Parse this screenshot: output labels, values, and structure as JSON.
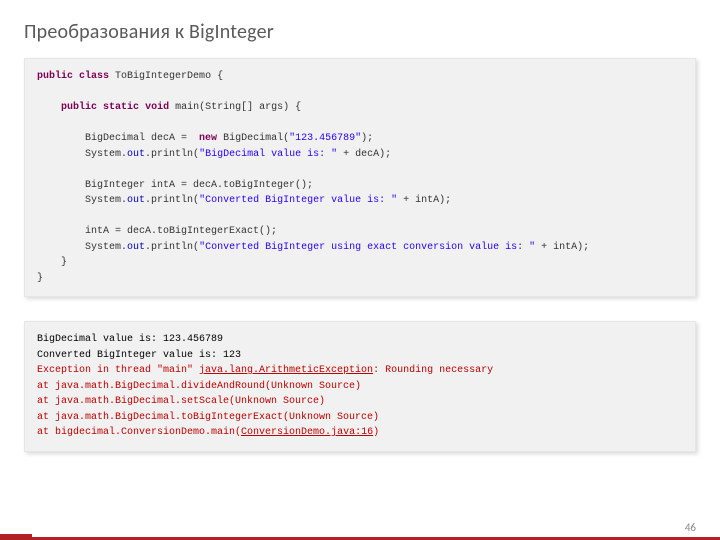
{
  "title": "Преобразования к BigInteger",
  "code": {
    "l1_kw1": "public",
    "l1_kw2": "class",
    "l1_rest": " ToBigIntegerDemo {",
    "l2_pad": "    ",
    "l2_kw1": "public",
    "l2_kw2": "static",
    "l2_kw3": "void",
    "l2_rest": " main(String[] args) {",
    "l3_pad": "        ",
    "l3_a": "BigDecimal decA =  ",
    "l3_kw": "new",
    "l3_b": " BigDecimal(",
    "l3_str": "\"123.456789\"",
    "l3_c": ");",
    "l4_pad": "        ",
    "l4_a": "System.",
    "l4_out": "out",
    "l4_b": ".println(",
    "l4_str": "\"BigDecimal value is: \"",
    "l4_c": " + decA);",
    "l5_pad": "        ",
    "l5_a": "BigInteger intA = decA.toBigInteger();",
    "l6_pad": "        ",
    "l6_a": "System.",
    "l6_out": "out",
    "l6_b": ".println(",
    "l6_str": "\"Converted BigInteger value is: \"",
    "l6_c": " + intA);",
    "l7_pad": "        ",
    "l7_a": "intA = decA.toBigIntegerExact();",
    "l8_pad": "        ",
    "l8_a": "System.",
    "l8_out": "out",
    "l8_b": ".println(",
    "l8_str": "\"Converted BigInteger using exact conversion value is: \"",
    "l8_c": " + intA);",
    "l9_pad": "    ",
    "l9_a": "}",
    "l10_a": "}"
  },
  "output": {
    "line1": "BigDecimal value is: 123.456789",
    "line2": "Converted BigInteger value is: 123",
    "err_a": "Exception in thread \"main\" ",
    "err_link1": "java.lang.ArithmeticException",
    "err_b": ": Rounding necessary",
    "err_l4": "at java.math.BigDecimal.divideAndRound(Unknown Source)",
    "err_l5": "at java.math.BigDecimal.setScale(Unknown Source)",
    "err_l6": "at java.math.BigDecimal.toBigIntegerExact(Unknown Source)",
    "err_l7a": "at bigdecimal.ConversionDemo.main(",
    "err_link2": "ConversionDemo.java:16",
    "err_l7b": ")"
  },
  "pagenum": "46"
}
